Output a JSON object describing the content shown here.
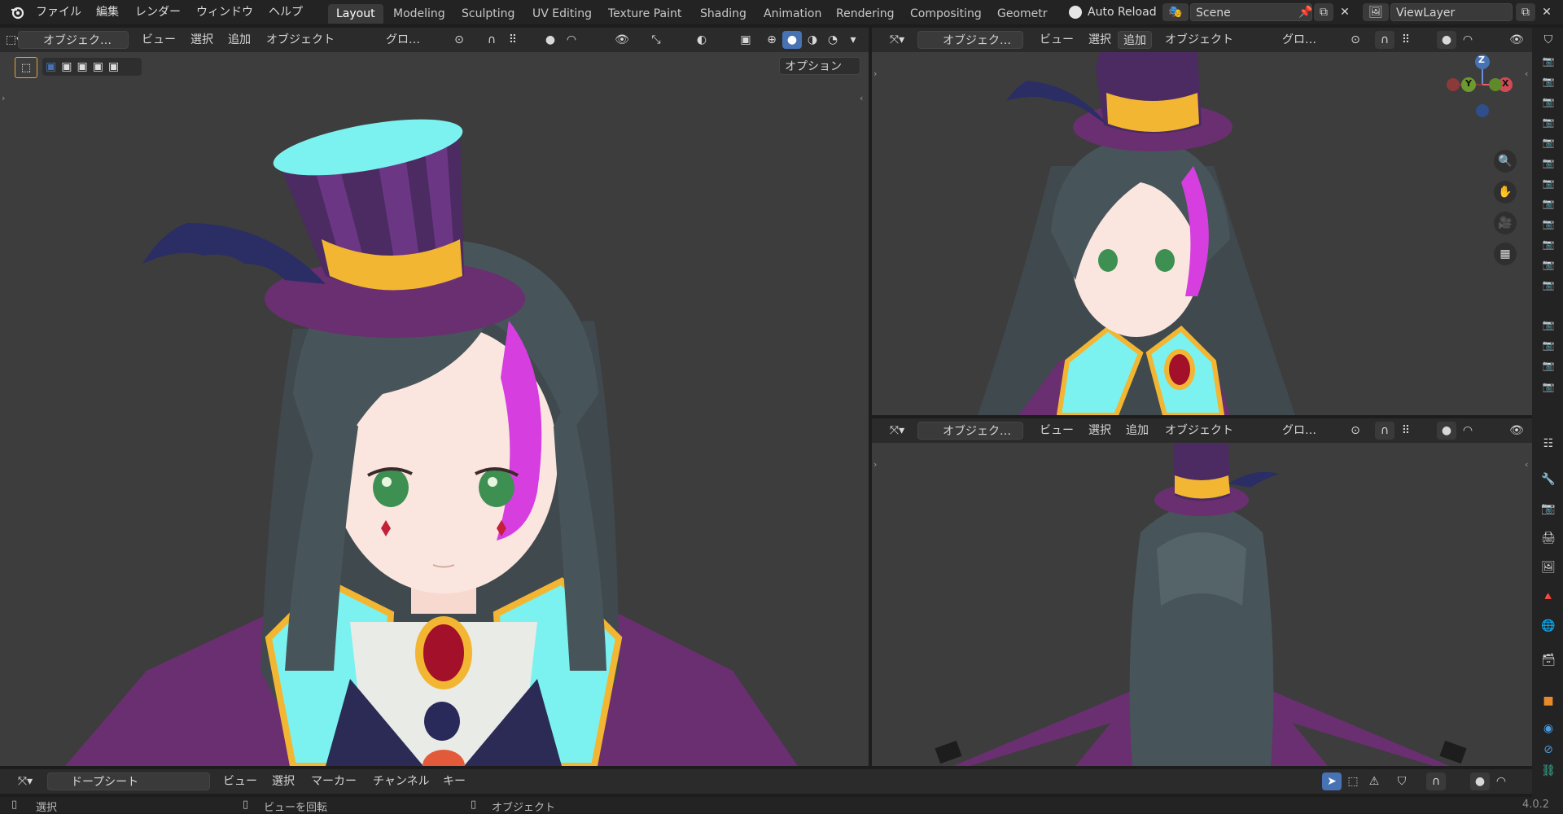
{
  "app": {
    "version": "4.0.2"
  },
  "menus": [
    "ファイル",
    "編集",
    "レンダー",
    "ウィンドウ",
    "ヘルプ"
  ],
  "workspaces": [
    {
      "label": "Layout",
      "active": true
    },
    {
      "label": "Modeling"
    },
    {
      "label": "Sculpting"
    },
    {
      "label": "UV Editing"
    },
    {
      "label": "Texture Paint"
    },
    {
      "label": "Shading"
    },
    {
      "label": "Animation"
    },
    {
      "label": "Rendering"
    },
    {
      "label": "Compositing"
    },
    {
      "label": "Geometr"
    }
  ],
  "top_right": {
    "auto_reload": "Auto Reload",
    "scene": "Scene",
    "view_layer": "ViewLayer"
  },
  "viewport_header": {
    "mode": "オブジェク…",
    "menus": [
      "ビュー",
      "選択",
      "追加",
      "オブジェクト"
    ],
    "orientation": "グロ…",
    "options": "オプション"
  },
  "timeline_header": {
    "editor": "ドープシート",
    "menus": [
      "ビュー",
      "選択",
      "マーカー",
      "チャンネル",
      "キー"
    ]
  },
  "status_bar": {
    "left": "選択",
    "middle": "ビューを回転",
    "right": "オブジェクト"
  },
  "gizmo": {
    "z": "Z",
    "y": "Y",
    "x": "X"
  },
  "colors": {
    "accent": "#4772b3",
    "hair": "#47555a",
    "hat": "#5b2e6b",
    "hat_band": "#f2b632",
    "collar": "#7cf2f0",
    "gem": "#a3102a",
    "cape": "#6a2f70",
    "streak": "#d63ee0"
  }
}
